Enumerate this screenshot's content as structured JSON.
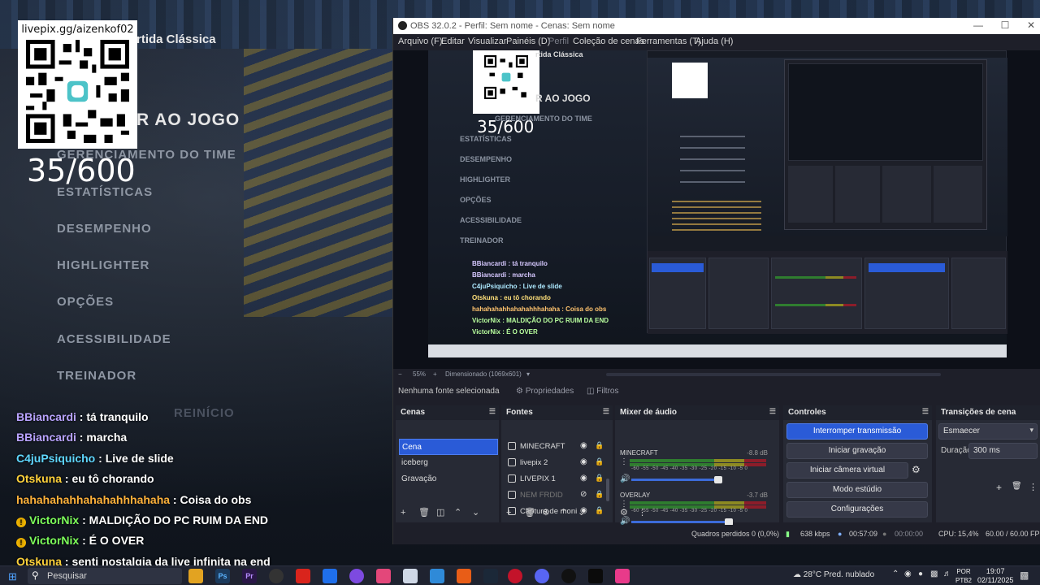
{
  "stream_overlay": {
    "qr_url": "livepix.gg/aizenkof02",
    "donation_counter": "35/600",
    "match_title": "rtida Clássica",
    "menu_head": "R AO JOGO",
    "menu_items": [
      "GERENCIAMENTO DO TIME",
      "ESTATÍSTICAS",
      "DESEMPENHO",
      "HIGHLIGHTER",
      "OPÇÕES",
      "ACESSIBILIDADE",
      "TREINADOR"
    ],
    "menu_hidden": "REINÍCIO"
  },
  "chat": [
    {
      "user": "BBiancardi",
      "color": "#b9a3ff",
      "msg": "tá tranquilo",
      "badge": false
    },
    {
      "user": "BBiancardi",
      "color": "#b9a3ff",
      "msg": "marcha",
      "badge": false
    },
    {
      "user": "C4juPsiquicho",
      "color": "#5fd7ff",
      "msg": "Live de slide",
      "badge": false
    },
    {
      "user": "Otskuna",
      "color": "#ffd23a",
      "msg": "eu tô chorando",
      "badge": false
    },
    {
      "user": "hahahahahhahahahhhahaha",
      "color": "#ffb13a",
      "msg": "Coisa do obs",
      "badge": false
    },
    {
      "user": "VictorNix",
      "color": "#7dff5a",
      "msg": "MALDIÇÃO DO PC RUIM DA END",
      "badge": true
    },
    {
      "user": "VictorNix",
      "color": "#7dff5a",
      "msg": "É O OVER",
      "badge": true
    },
    {
      "user": "Otskuna",
      "color": "#ffd23a",
      "msg": "senti nostalgia da live infinita na end",
      "badge": false
    }
  ],
  "obs": {
    "title": "OBS 32.0.2 - Perfil: Sem nome - Cenas: Sem nome",
    "menu": [
      "Arquivo (F)",
      "Editar",
      "Visualizar",
      "Painéis (D)",
      "Perfil",
      "Coleção de cenas",
      "Ferramentas (T)",
      "Ajuda (H)"
    ],
    "zoom": "55%",
    "dimension": "Dimensionado (1069x601)",
    "no_source": "Nenhuma fonte selecionada",
    "properties": "Propriedades",
    "filters": "Filtros",
    "docks": {
      "scenes": {
        "title": "Cenas",
        "items": [
          "Cena",
          "iceberg",
          "Gravação"
        ],
        "active": 0
      },
      "sources": {
        "title": "Fontes",
        "items": [
          {
            "name": "MINECRAFT",
            "visible": true,
            "dim": false
          },
          {
            "name": "livepix 2",
            "visible": true,
            "dim": false
          },
          {
            "name": "LIVEPIX 1",
            "visible": true,
            "dim": false
          },
          {
            "name": "NEM FRDID",
            "visible": false,
            "dim": true
          },
          {
            "name": "Captura de moni",
            "visible": true,
            "dim": false
          }
        ]
      },
      "mixer": {
        "title": "Mixer de áudio",
        "channels": [
          {
            "name": "MINECRAFT",
            "db": "-8.8 dB",
            "level": 0.62
          },
          {
            "name": "OVERLAY",
            "db": "-3.7 dB",
            "level": 0.7
          }
        ],
        "scale": "-60 -55 -50 -45 -40 -35 -30 -25 -20 -15 -10 -5 0"
      },
      "controls": {
        "title": "Controles",
        "buttons": [
          "Interromper transmissão",
          "Iniciar gravação",
          "Iniciar câmera virtual",
          "Modo estúdio",
          "Configurações"
        ]
      },
      "transitions": {
        "title": "Transições de cena",
        "type": "Esmaecer",
        "duration_label": "Duração",
        "duration": "300 ms"
      }
    },
    "status": {
      "dropped": "Quadros perdidos 0 (0,0%)",
      "bitrate": "638 kbps",
      "live_time": "00:57:09",
      "rec_time": "00:00:00",
      "cpu": "CPU: 15,4%",
      "fps": "60.00 / 60.00 FPS"
    }
  },
  "preview_overlay": {
    "counter": "35/600",
    "title": "rtida Clássica",
    "head": "R AO JOGO",
    "items": [
      "GERENCIAMENTO DO TIME",
      "ESTATÍSTICAS",
      "DESEMPENHO",
      "HIGHLIGHTER",
      "OPÇÕES",
      "ACESSIBILIDADE",
      "TREINADOR"
    ],
    "chat": [
      "BBiancardi : tá tranquilo",
      "BBiancardi : marcha",
      "C4juPsiquicho : Live de slide",
      "Otskuna : eu tô chorando",
      "hahahahahhahahahhhahaha : Coisa do obs",
      "VictorNix : MALDIÇÃO DO PC RUIM DA END",
      "VictorNix : É O OVER"
    ]
  },
  "taskbar": {
    "search": "Pesquisar",
    "weather_temp": "28°C",
    "weather_desc": "Pred. nublado",
    "lang": "POR",
    "lang2": "PTB2",
    "time": "19:07",
    "date": "02/11/2025"
  }
}
